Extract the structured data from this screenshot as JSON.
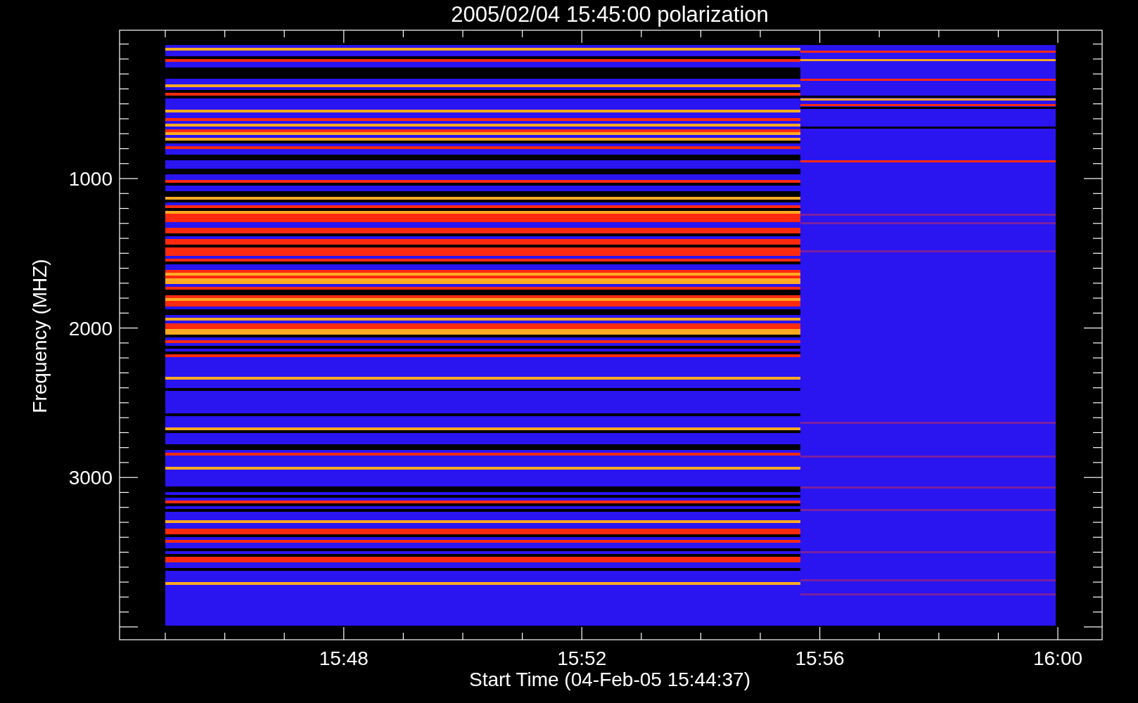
{
  "title": "2005/02/04 15:45:00 polarization",
  "y_axis": {
    "label": "Frequency (MHZ)",
    "tick_labels": [
      "1000",
      "2000",
      "3000"
    ]
  },
  "x_axis": {
    "label": "Start Time (04-Feb-05 15:44:37)",
    "tick_labels": [
      "15:48",
      "15:52",
      "15:56",
      "16:00"
    ]
  }
}
